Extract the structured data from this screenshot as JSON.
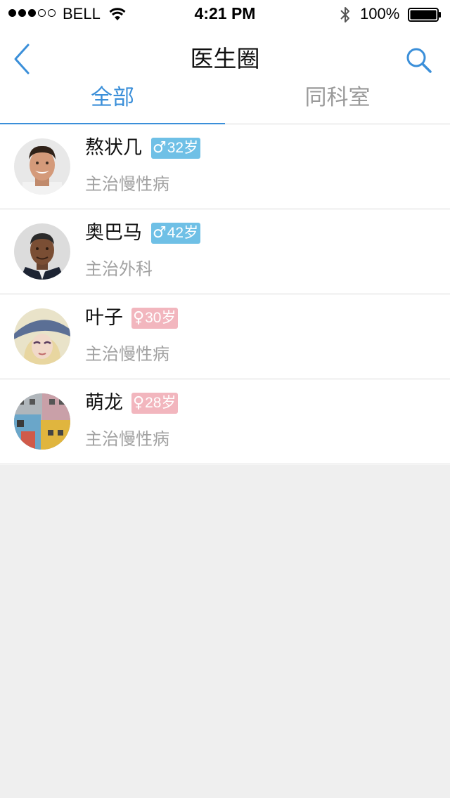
{
  "status_bar": {
    "carrier": "BELL",
    "time": "4:21 PM",
    "battery": "100%",
    "signal_strength": 3,
    "signal_max": 5
  },
  "nav": {
    "title": "医生圈",
    "back_icon": "chevron-left-icon",
    "search_icon": "search-icon"
  },
  "tabs": [
    {
      "label": "全部",
      "active": true
    },
    {
      "label": "同科室",
      "active": false
    }
  ],
  "doctors": [
    {
      "name": "熬状几",
      "gender": "male",
      "gender_symbol": "♂",
      "age": "32岁",
      "description": "主治慢性病"
    },
    {
      "name": "奥巴马",
      "gender": "male",
      "gender_symbol": "♂",
      "age": "42岁",
      "description": "主治外科"
    },
    {
      "name": "叶子",
      "gender": "female",
      "gender_symbol": "♀",
      "age": "30岁",
      "description": "主治慢性病"
    },
    {
      "name": "萌龙",
      "gender": "female",
      "gender_symbol": "♀",
      "age": "28岁",
      "description": "主治慢性病"
    }
  ],
  "colors": {
    "accent": "#3b8fd9",
    "male_badge": "#6fc0e6",
    "female_badge": "#f2b6be",
    "background": "#efefef"
  }
}
